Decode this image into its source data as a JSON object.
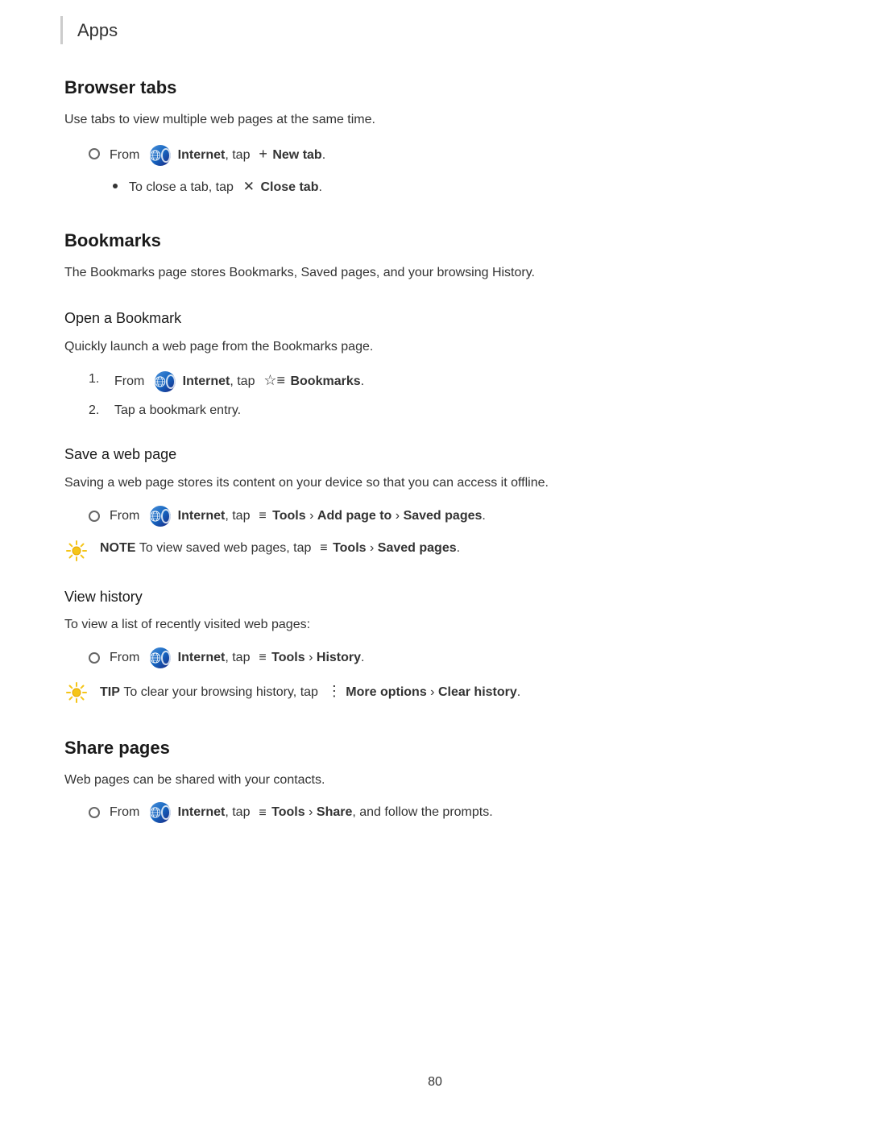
{
  "header": {
    "apps_label": "Apps"
  },
  "sections": {
    "browser_tabs": {
      "title": "Browser tabs",
      "description": "Use tabs to view multiple web pages at the same time.",
      "instruction1": {
        "prefix": "From",
        "app": "Internet",
        "middle": ", tap",
        "action": "New tab",
        "suffix": "."
      },
      "sub_instruction1": {
        "prefix": "To close a tab, tap",
        "action": "Close tab",
        "suffix": "."
      }
    },
    "bookmarks": {
      "title": "Bookmarks",
      "description": "The Bookmarks page stores Bookmarks, Saved pages, and your browsing History.",
      "open_bookmark": {
        "subtitle": "Open a Bookmark",
        "description": "Quickly launch a web page from the Bookmarks page.",
        "step1_prefix": "From",
        "step1_app": "Internet",
        "step1_middle": ", tap",
        "step1_action": "Bookmarks",
        "step1_suffix": ".",
        "step2": "Tap a bookmark entry."
      },
      "save_web_page": {
        "subtitle": "Save a web page",
        "description": "Saving a web page stores its content on your device so that you can access it offline.",
        "instruction_prefix": "From",
        "instruction_app": "Internet",
        "instruction_middle": ", tap",
        "instruction_action1": "Tools",
        "instruction_arrow1": "›",
        "instruction_action2": "Add page to",
        "instruction_arrow2": "›",
        "instruction_action3": "Saved pages",
        "instruction_suffix": ".",
        "note_label": "NOTE",
        "note_text": "To view saved web pages, tap",
        "note_action1": "Tools",
        "note_arrow": "›",
        "note_action2": "Saved pages",
        "note_suffix": "."
      },
      "view_history": {
        "subtitle": "View history",
        "description": "To view a list of recently visited web pages:",
        "instruction_prefix": "From",
        "instruction_app": "Internet",
        "instruction_middle": ", tap",
        "instruction_action1": "Tools",
        "instruction_arrow": "›",
        "instruction_action2": "History",
        "instruction_suffix": ".",
        "tip_label": "TIP",
        "tip_text": "To clear your browsing history, tap",
        "tip_action1": "More options",
        "tip_arrow": "›",
        "tip_action2": "Clear history",
        "tip_suffix": "."
      }
    },
    "share_pages": {
      "title": "Share pages",
      "description": "Web pages can be shared with your contacts.",
      "instruction_prefix": "From",
      "instruction_app": "Internet",
      "instruction_middle": ", tap",
      "instruction_action1": "Tools",
      "instruction_arrow": "›",
      "instruction_action2": "Share",
      "instruction_suffix": ", and follow the prompts."
    }
  },
  "footer": {
    "page_number": "80"
  }
}
